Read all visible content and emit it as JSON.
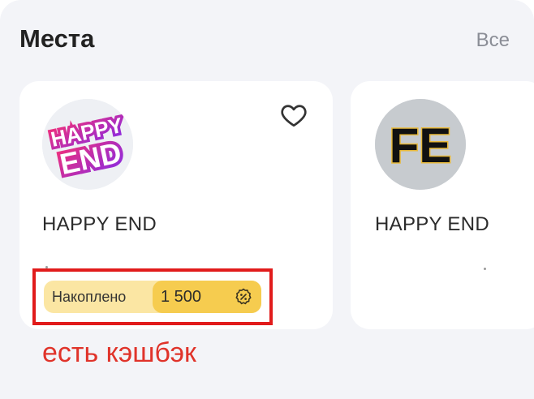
{
  "section": {
    "title": "Места",
    "see_all": "Все"
  },
  "places": [
    {
      "name": "HAPPY END",
      "logo_icon": "happy-end-logo",
      "logo_text_top": "HAPPY",
      "logo_text_bottom": "END",
      "favorite_icon": "heart-outline-icon",
      "cashback": {
        "label": "Накоплено",
        "amount": "1 500",
        "icon": "percent-badge-icon"
      }
    },
    {
      "name": "HAPPY END",
      "logo_icon": "fe-letters-logo",
      "logo_text": "FE"
    }
  ],
  "annotation": {
    "text": "есть кэшбэк",
    "color": "#e0332a"
  },
  "colors": {
    "panel_bg": "#f3f4f8",
    "card_bg": "#ffffff",
    "cashback_bg": "#fbe6a3",
    "cashback_pill": "#f6cc4f",
    "highlight_border": "#e11b1b",
    "logo_pink": "#e8287a",
    "logo_purple": "#8a2be2"
  }
}
